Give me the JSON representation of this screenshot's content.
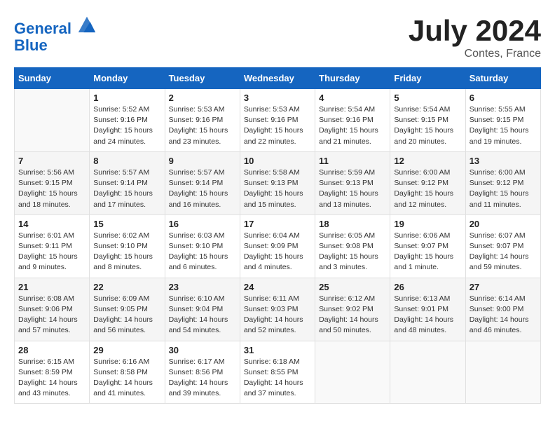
{
  "header": {
    "logo_line1": "General",
    "logo_line2": "Blue",
    "month_year": "July 2024",
    "location": "Contes, France"
  },
  "days_of_week": [
    "Sunday",
    "Monday",
    "Tuesday",
    "Wednesday",
    "Thursday",
    "Friday",
    "Saturday"
  ],
  "weeks": [
    [
      {
        "day": "",
        "sunrise": "",
        "sunset": "",
        "daylight": ""
      },
      {
        "day": "1",
        "sunrise": "Sunrise: 5:52 AM",
        "sunset": "Sunset: 9:16 PM",
        "daylight": "Daylight: 15 hours and 24 minutes."
      },
      {
        "day": "2",
        "sunrise": "Sunrise: 5:53 AM",
        "sunset": "Sunset: 9:16 PM",
        "daylight": "Daylight: 15 hours and 23 minutes."
      },
      {
        "day": "3",
        "sunrise": "Sunrise: 5:53 AM",
        "sunset": "Sunset: 9:16 PM",
        "daylight": "Daylight: 15 hours and 22 minutes."
      },
      {
        "day": "4",
        "sunrise": "Sunrise: 5:54 AM",
        "sunset": "Sunset: 9:16 PM",
        "daylight": "Daylight: 15 hours and 21 minutes."
      },
      {
        "day": "5",
        "sunrise": "Sunrise: 5:54 AM",
        "sunset": "Sunset: 9:15 PM",
        "daylight": "Daylight: 15 hours and 20 minutes."
      },
      {
        "day": "6",
        "sunrise": "Sunrise: 5:55 AM",
        "sunset": "Sunset: 9:15 PM",
        "daylight": "Daylight: 15 hours and 19 minutes."
      }
    ],
    [
      {
        "day": "7",
        "sunrise": "Sunrise: 5:56 AM",
        "sunset": "Sunset: 9:15 PM",
        "daylight": "Daylight: 15 hours and 18 minutes."
      },
      {
        "day": "8",
        "sunrise": "Sunrise: 5:57 AM",
        "sunset": "Sunset: 9:14 PM",
        "daylight": "Daylight: 15 hours and 17 minutes."
      },
      {
        "day": "9",
        "sunrise": "Sunrise: 5:57 AM",
        "sunset": "Sunset: 9:14 PM",
        "daylight": "Daylight: 15 hours and 16 minutes."
      },
      {
        "day": "10",
        "sunrise": "Sunrise: 5:58 AM",
        "sunset": "Sunset: 9:13 PM",
        "daylight": "Daylight: 15 hours and 15 minutes."
      },
      {
        "day": "11",
        "sunrise": "Sunrise: 5:59 AM",
        "sunset": "Sunset: 9:13 PM",
        "daylight": "Daylight: 15 hours and 13 minutes."
      },
      {
        "day": "12",
        "sunrise": "Sunrise: 6:00 AM",
        "sunset": "Sunset: 9:12 PM",
        "daylight": "Daylight: 15 hours and 12 minutes."
      },
      {
        "day": "13",
        "sunrise": "Sunrise: 6:00 AM",
        "sunset": "Sunset: 9:12 PM",
        "daylight": "Daylight: 15 hours and 11 minutes."
      }
    ],
    [
      {
        "day": "14",
        "sunrise": "Sunrise: 6:01 AM",
        "sunset": "Sunset: 9:11 PM",
        "daylight": "Daylight: 15 hours and 9 minutes."
      },
      {
        "day": "15",
        "sunrise": "Sunrise: 6:02 AM",
        "sunset": "Sunset: 9:10 PM",
        "daylight": "Daylight: 15 hours and 8 minutes."
      },
      {
        "day": "16",
        "sunrise": "Sunrise: 6:03 AM",
        "sunset": "Sunset: 9:10 PM",
        "daylight": "Daylight: 15 hours and 6 minutes."
      },
      {
        "day": "17",
        "sunrise": "Sunrise: 6:04 AM",
        "sunset": "Sunset: 9:09 PM",
        "daylight": "Daylight: 15 hours and 4 minutes."
      },
      {
        "day": "18",
        "sunrise": "Sunrise: 6:05 AM",
        "sunset": "Sunset: 9:08 PM",
        "daylight": "Daylight: 15 hours and 3 minutes."
      },
      {
        "day": "19",
        "sunrise": "Sunrise: 6:06 AM",
        "sunset": "Sunset: 9:07 PM",
        "daylight": "Daylight: 15 hours and 1 minute."
      },
      {
        "day": "20",
        "sunrise": "Sunrise: 6:07 AM",
        "sunset": "Sunset: 9:07 PM",
        "daylight": "Daylight: 14 hours and 59 minutes."
      }
    ],
    [
      {
        "day": "21",
        "sunrise": "Sunrise: 6:08 AM",
        "sunset": "Sunset: 9:06 PM",
        "daylight": "Daylight: 14 hours and 57 minutes."
      },
      {
        "day": "22",
        "sunrise": "Sunrise: 6:09 AM",
        "sunset": "Sunset: 9:05 PM",
        "daylight": "Daylight: 14 hours and 56 minutes."
      },
      {
        "day": "23",
        "sunrise": "Sunrise: 6:10 AM",
        "sunset": "Sunset: 9:04 PM",
        "daylight": "Daylight: 14 hours and 54 minutes."
      },
      {
        "day": "24",
        "sunrise": "Sunrise: 6:11 AM",
        "sunset": "Sunset: 9:03 PM",
        "daylight": "Daylight: 14 hours and 52 minutes."
      },
      {
        "day": "25",
        "sunrise": "Sunrise: 6:12 AM",
        "sunset": "Sunset: 9:02 PM",
        "daylight": "Daylight: 14 hours and 50 minutes."
      },
      {
        "day": "26",
        "sunrise": "Sunrise: 6:13 AM",
        "sunset": "Sunset: 9:01 PM",
        "daylight": "Daylight: 14 hours and 48 minutes."
      },
      {
        "day": "27",
        "sunrise": "Sunrise: 6:14 AM",
        "sunset": "Sunset: 9:00 PM",
        "daylight": "Daylight: 14 hours and 46 minutes."
      }
    ],
    [
      {
        "day": "28",
        "sunrise": "Sunrise: 6:15 AM",
        "sunset": "Sunset: 8:59 PM",
        "daylight": "Daylight: 14 hours and 43 minutes."
      },
      {
        "day": "29",
        "sunrise": "Sunrise: 6:16 AM",
        "sunset": "Sunset: 8:58 PM",
        "daylight": "Daylight: 14 hours and 41 minutes."
      },
      {
        "day": "30",
        "sunrise": "Sunrise: 6:17 AM",
        "sunset": "Sunset: 8:56 PM",
        "daylight": "Daylight: 14 hours and 39 minutes."
      },
      {
        "day": "31",
        "sunrise": "Sunrise: 6:18 AM",
        "sunset": "Sunset: 8:55 PM",
        "daylight": "Daylight: 14 hours and 37 minutes."
      },
      {
        "day": "",
        "sunrise": "",
        "sunset": "",
        "daylight": ""
      },
      {
        "day": "",
        "sunrise": "",
        "sunset": "",
        "daylight": ""
      },
      {
        "day": "",
        "sunrise": "",
        "sunset": "",
        "daylight": ""
      }
    ]
  ]
}
